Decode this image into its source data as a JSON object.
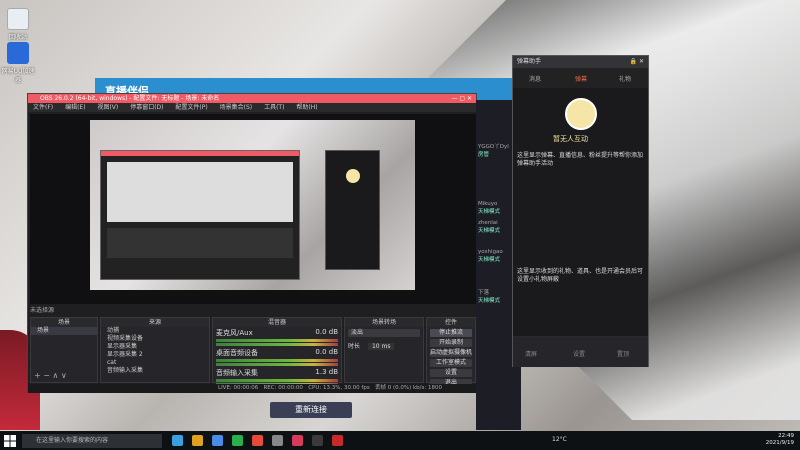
{
  "desktop": {
    "icons": [
      {
        "label": "回收站"
      },
      {
        "label": "网易UU加速器"
      }
    ]
  },
  "bg_window": {
    "title": "直播伴侣"
  },
  "obs": {
    "title": "OBS 26.0.2 (64-bit, windows) - 配置文件: 无标题 - 场景: 未命名",
    "menu": [
      "文件(F)",
      "编辑(E)",
      "视图(V)",
      "停靠窗口(D)",
      "配置文件(P)",
      "场景集合(S)",
      "工具(T)",
      "帮助(H)"
    ],
    "no_source_label": "未选择源",
    "docks": {
      "scenes": {
        "title": "场景",
        "items": [
          "场景"
        ]
      },
      "sources": {
        "title": "来源",
        "items": [
          "动捕",
          "视频采集设备",
          "显示器采集",
          "显示器采集 2",
          "cat",
          "音频输入采集"
        ]
      },
      "mixer": {
        "title": "混音器",
        "channels": [
          {
            "name": "麦克风/Aux",
            "db": "0.0 dB"
          },
          {
            "name": "桌面音频设备",
            "db": "0.0 dB"
          },
          {
            "name": "音频输入采集",
            "db": "1.3 dB"
          }
        ]
      },
      "transitions": {
        "title": "场景转场",
        "type": "淡出",
        "duration_label": "时长",
        "duration": "10 ms"
      },
      "controls": {
        "title": "控件",
        "buttons": [
          "停止推流",
          "开始录制",
          "启动虚拟摄像机",
          "工作室模式",
          "设置",
          "退出"
        ]
      }
    },
    "status": {
      "live": "LIVE: 00:00:06",
      "rec": "REC: 00:00:00",
      "cpu": "CPU: 13.3%, 30.00 fps",
      "bitrate": "丢帧 0 (0.0%)  kb/s: 1800"
    }
  },
  "reconnect_button": "重新连接",
  "chat": {
    "rows": [
      {
        "name": "YGGO丫Dyl",
        "badge": "房管"
      },
      {
        "name": "Mikuyo",
        "badge": "天梯模式"
      },
      {
        "name": "zhenlai",
        "badge": "天梯模式"
      },
      {
        "name": "yoshigao",
        "badge": "天梯模式"
      },
      {
        "name": "下落",
        "badge": "天梯模式"
      }
    ]
  },
  "helper": {
    "title": "弹幕助手",
    "tabs": [
      "消息",
      "弹幕",
      "礼物"
    ],
    "mascot_caption": "暂无人互动",
    "text1": "这里显示弹幕、直播信息、粉丝提升等帮你添加弹幕助手活动",
    "text2": "这里显示收到的礼物、道具、也是开通会员后可设置小礼物屏蔽",
    "footer": [
      "清屏",
      "设置",
      "置顶"
    ]
  },
  "taskbar": {
    "search_placeholder": "在这里输入你要搜索的内容",
    "weather": "12°C",
    "time": "22:49",
    "date": "2021/9/19",
    "icon_colors": [
      "#3aa0e0",
      "#e0a020",
      "#4a8ae8",
      "#2ab04a",
      "#e84a3a",
      "#888888",
      "#d83a5a",
      "#3a3a3a",
      "#c82a2a"
    ]
  }
}
